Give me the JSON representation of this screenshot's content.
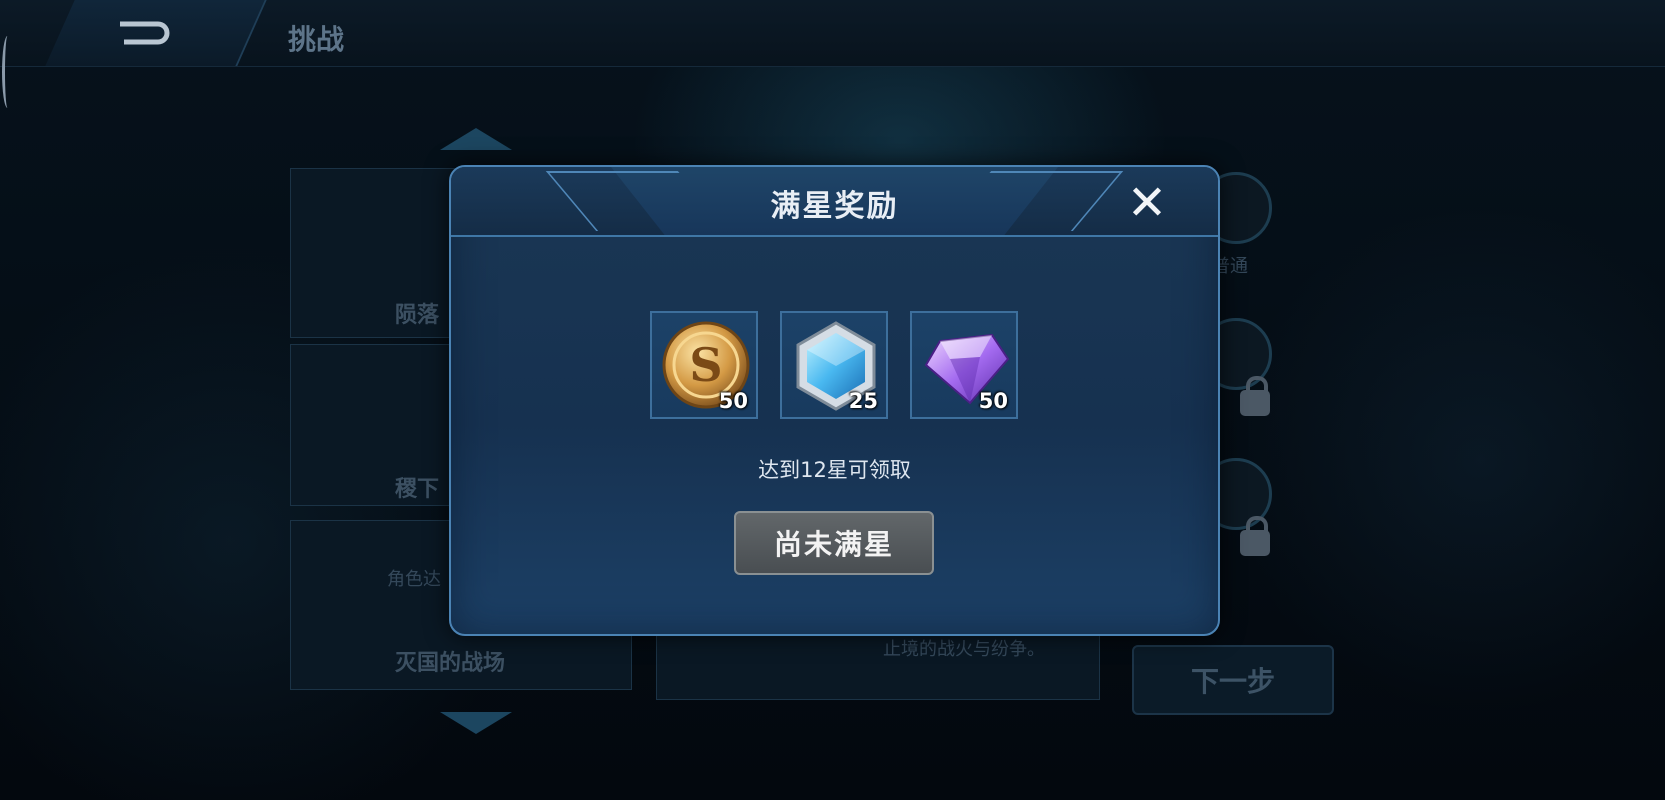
{
  "top_bar": {
    "title": "挑战"
  },
  "background": {
    "level_labels": [
      "陨落",
      "稷下",
      "灭国的战场"
    ],
    "level_hint": "角色达",
    "description_text": "止境的战火与纷争。",
    "side_label": "普通",
    "next_button_label": "下一步"
  },
  "modal": {
    "title": "满星奖励",
    "close_symbol": "✕",
    "rewards": [
      {
        "icon": "gold-coin-icon",
        "quantity": "50"
      },
      {
        "icon": "blue-crystal-icon",
        "quantity": "25"
      },
      {
        "icon": "purple-diamond-icon",
        "quantity": "50"
      }
    ],
    "hint": "达到12星可领取",
    "status_button_label": "尚未满星"
  }
}
